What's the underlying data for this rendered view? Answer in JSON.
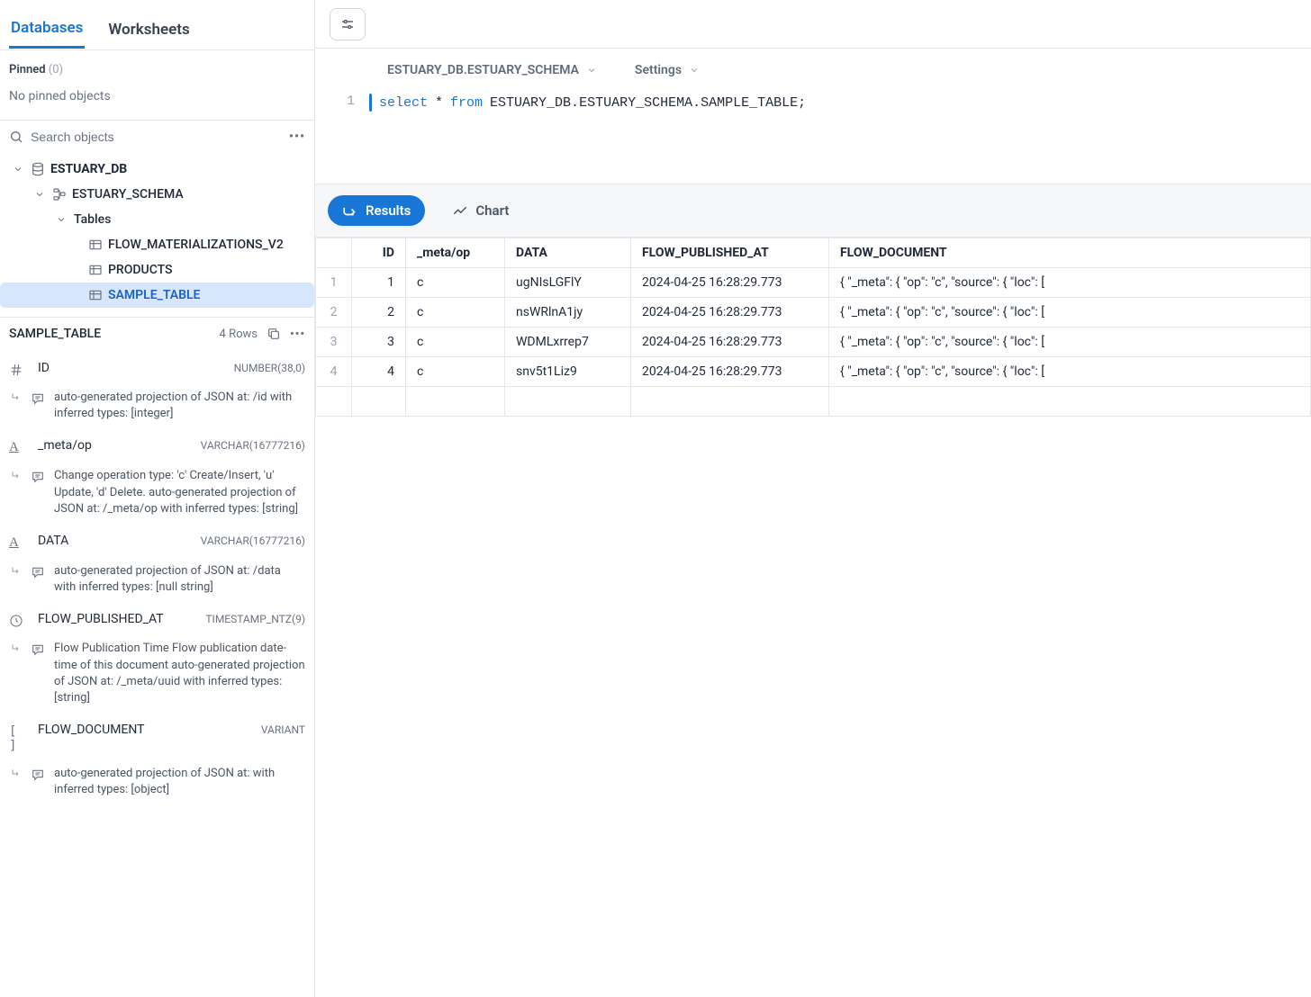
{
  "tabs": {
    "databases": "Databases",
    "worksheets": "Worksheets"
  },
  "pinned": {
    "label": "Pinned",
    "count": "(0)",
    "empty": "No pinned objects"
  },
  "search": {
    "placeholder": "Search objects"
  },
  "tree": {
    "db": "ESTUARY_DB",
    "schema": "ESTUARY_SCHEMA",
    "tables_label": "Tables",
    "tables": [
      "FLOW_MATERIALIZATIONS_V2",
      "PRODUCTS",
      "SAMPLE_TABLE"
    ]
  },
  "details": {
    "title": "SAMPLE_TABLE",
    "rows_label": "4 Rows",
    "columns": [
      {
        "icon": "hash",
        "name": "ID",
        "type": "NUMBER(38,0)",
        "desc": "auto-generated projection of JSON at: /id with inferred types: [integer]"
      },
      {
        "icon": "text",
        "name": "_meta/op",
        "type": "VARCHAR(16777216)",
        "desc": "Change operation type: 'c' Create/Insert, 'u' Update, 'd' Delete. auto-generated projection of JSON at: /_meta/op with inferred types: [string]"
      },
      {
        "icon": "text",
        "name": "DATA",
        "type": "VARCHAR(16777216)",
        "desc": "auto-generated projection of JSON at: /data with inferred types: [null string]"
      },
      {
        "icon": "clock",
        "name": "FLOW_PUBLISHED_AT",
        "type": "TIMESTAMP_NTZ(9)",
        "desc": "Flow Publication Time Flow publication date-time of this document auto-generated projection of JSON at: /_meta/uuid with inferred types: [string]"
      },
      {
        "icon": "braces",
        "name": "FLOW_DOCUMENT",
        "type": "VARIANT",
        "desc": "auto-generated projection of JSON at: with inferred types: [object]"
      }
    ]
  },
  "context": {
    "path": "ESTUARY_DB.ESTUARY_SCHEMA",
    "settings": "Settings"
  },
  "sql": {
    "kw1": "select",
    "star": "*",
    "kw2": "from",
    "ident": "ESTUARY_DB.ESTUARY_SCHEMA.SAMPLE_TABLE;"
  },
  "result_tabs": {
    "results": "Results",
    "chart": "Chart"
  },
  "grid": {
    "headers": [
      "ID",
      "_meta/op",
      "DATA",
      "FLOW_PUBLISHED_AT",
      "FLOW_DOCUMENT"
    ],
    "rows": [
      {
        "n": "1",
        "id": "1",
        "op": "c",
        "data": "ugNIsLGFlY",
        "pub": "2024-04-25 16:28:29.773",
        "doc": "{   \"_meta\": {     \"op\": \"c\",     \"source\": {       \"loc\": ["
      },
      {
        "n": "2",
        "id": "2",
        "op": "c",
        "data": "nsWRlnA1jy",
        "pub": "2024-04-25 16:28:29.773",
        "doc": "{   \"_meta\": {     \"op\": \"c\",     \"source\": {       \"loc\": ["
      },
      {
        "n": "3",
        "id": "3",
        "op": "c",
        "data": "WDMLxrrep7",
        "pub": "2024-04-25 16:28:29.773",
        "doc": "{   \"_meta\": {     \"op\": \"c\",     \"source\": {       \"loc\": ["
      },
      {
        "n": "4",
        "id": "4",
        "op": "c",
        "data": "snv5t1Liz9",
        "pub": "2024-04-25 16:28:29.773",
        "doc": "{   \"_meta\": {     \"op\": \"c\",     \"source\": {       \"loc\": ["
      }
    ]
  }
}
